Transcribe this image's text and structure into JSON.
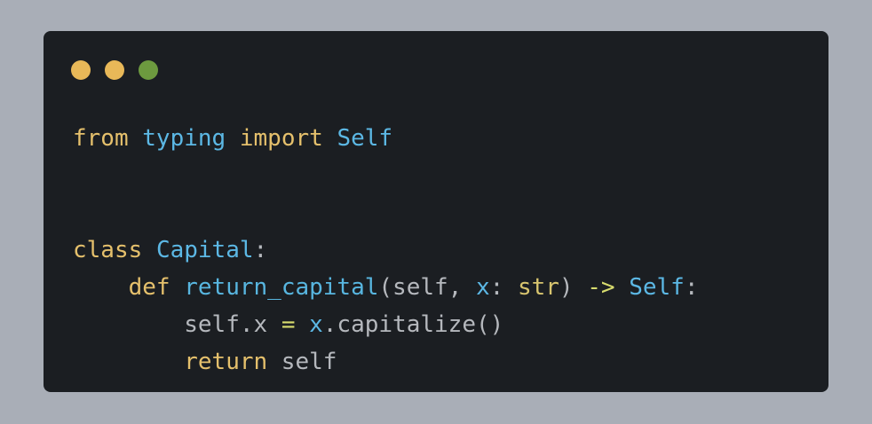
{
  "window": {
    "control_colors": {
      "close": "#e8b858",
      "minimize": "#e8b858",
      "maximize": "#6d9a3f"
    }
  },
  "code_lines": [
    [
      {
        "t": "from",
        "k": "kw"
      },
      {
        "t": " ",
        "k": "plain"
      },
      {
        "t": "typing",
        "k": "ident"
      },
      {
        "t": " ",
        "k": "plain"
      },
      {
        "t": "import",
        "k": "kw"
      },
      {
        "t": " ",
        "k": "plain"
      },
      {
        "t": "Self",
        "k": "ident"
      }
    ],
    [],
    [],
    [
      {
        "t": "class",
        "k": "kw"
      },
      {
        "t": " ",
        "k": "plain"
      },
      {
        "t": "Capital",
        "k": "ident"
      },
      {
        "t": ":",
        "k": "plain"
      }
    ],
    [
      {
        "t": "    ",
        "k": "plain"
      },
      {
        "t": "def",
        "k": "kw"
      },
      {
        "t": " ",
        "k": "plain"
      },
      {
        "t": "return_capital",
        "k": "fn"
      },
      {
        "t": "(self, ",
        "k": "plain"
      },
      {
        "t": "x",
        "k": "ident"
      },
      {
        "t": ": ",
        "k": "plain"
      },
      {
        "t": "str",
        "k": "type"
      },
      {
        "t": ") ",
        "k": "plain"
      },
      {
        "t": "->",
        "k": "op"
      },
      {
        "t": " ",
        "k": "plain"
      },
      {
        "t": "Self",
        "k": "ident"
      },
      {
        "t": ":",
        "k": "plain"
      }
    ],
    [
      {
        "t": "        ",
        "k": "plain"
      },
      {
        "t": "self.x ",
        "k": "plain"
      },
      {
        "t": "=",
        "k": "op"
      },
      {
        "t": " ",
        "k": "plain"
      },
      {
        "t": "x",
        "k": "ident"
      },
      {
        "t": ".capitalize()",
        "k": "plain"
      }
    ],
    [
      {
        "t": "        ",
        "k": "plain"
      },
      {
        "t": "return",
        "k": "kw"
      },
      {
        "t": " self",
        "k": "plain"
      }
    ]
  ]
}
